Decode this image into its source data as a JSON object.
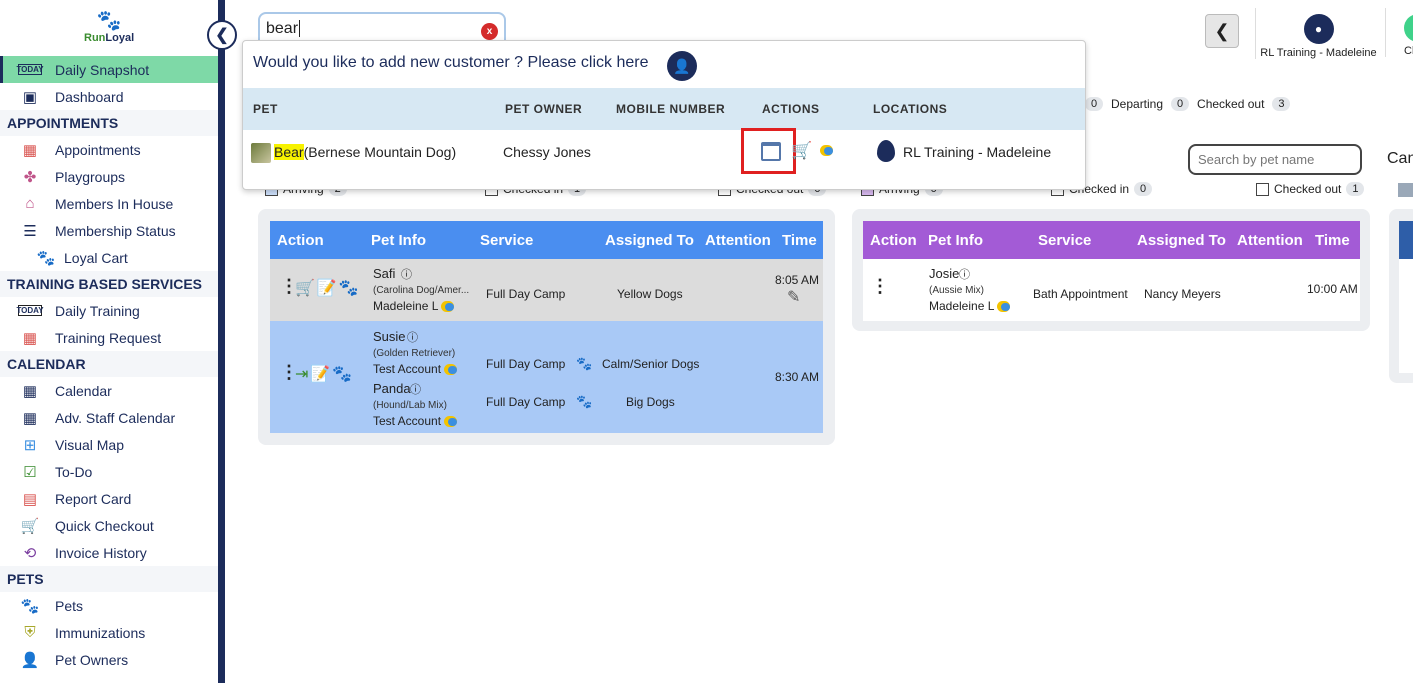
{
  "brand": {
    "logo_text_a": "Run",
    "logo_text_b": "Loyal"
  },
  "sidebar": {
    "items": [
      {
        "label": "Daily Snapshot",
        "icon": "today-icon",
        "active": true
      },
      {
        "label": "Dashboard",
        "icon": "dashboard-icon"
      }
    ],
    "sections": [
      {
        "title": "APPOINTMENTS",
        "items": [
          "Appointments",
          "Playgroups",
          "Members In House",
          "Membership Status",
          "Loyal Cart"
        ]
      },
      {
        "title": "TRAINING BASED SERVICES",
        "items": [
          "Daily Training",
          "Training Request"
        ]
      },
      {
        "title": "CALENDAR",
        "items": [
          "Calendar",
          "Adv. Staff Calendar",
          "Visual Map",
          "To-Do",
          "Report Card",
          "Quick Checkout",
          "Invoice History"
        ]
      },
      {
        "title": "PETS",
        "items": [
          "Pets",
          "Immunizations",
          "Pet Owners"
        ]
      }
    ]
  },
  "search": {
    "value": "bear",
    "clear_label": "x"
  },
  "header": {
    "location_label": "RL Training - Madeleine",
    "next_label": "Clo"
  },
  "status_bar": {
    "count_a": "0",
    "departing_label": "Departing",
    "departing_count": "0",
    "checked_out_label": "Checked out",
    "checked_out_count": "3"
  },
  "pet_search_placeholder": "Search by pet name",
  "cam_label": "Can",
  "filters": {
    "arriving": "Arriving",
    "arriving_count": "2",
    "checked_in": "Checked in",
    "checked_in_count": "1",
    "checked_out": "Checked out",
    "checked_out_count": "0",
    "arriving2": "Arriving",
    "arriving2_count": "0",
    "checked_in2": "Checked in",
    "checked_in2_count": "0",
    "checked_out2": "Checked out",
    "checked_out2_count": "1"
  },
  "table_headers": [
    "Action",
    "Pet Info",
    "Service",
    "Assigned To",
    "Attention",
    "Time"
  ],
  "blue_table": {
    "rows": [
      {
        "pet": "Safi",
        "breed": "(Carolina Dog/Amer...",
        "owner": "Madeleine L",
        "service": "Full Day Camp",
        "assigned": "Yellow Dogs",
        "time": "8:05 AM"
      },
      {
        "pet": "Susie",
        "breed": "(Golden Retriever)",
        "owner": "Test Account",
        "service": "Full Day Camp",
        "assigned": "Calm/Senior Dogs",
        "time": "8:30 AM",
        "pet2": "Panda",
        "breed2": "(Hound/Lab Mix)",
        "owner2": "Test Account",
        "service2": "Full Day Camp",
        "assigned2": "Big Dogs"
      }
    ]
  },
  "purple_table": {
    "rows": [
      {
        "pet": "Josie",
        "breed": "(Aussie Mix)",
        "owner": "Madeleine L",
        "service": "Bath Appointment",
        "assigned": "Nancy Meyers",
        "time": "10:00 AM"
      }
    ]
  },
  "dropdown": {
    "prompt": "Would you like to add new customer ? Please click here",
    "columns": [
      "PET",
      "PET OWNER",
      "MOBILE NUMBER",
      "ACTIONS",
      "LOCATIONS"
    ],
    "result": {
      "pet_highlight": "Bear",
      "pet_rest": "(Bernese Mountain Dog)",
      "owner": "Chessy Jones",
      "mobile": "",
      "location": "RL Training - Madeleine"
    }
  },
  "colors": {
    "navy": "#1c2c5b",
    "active_nav": "#7ed9a7",
    "blue_header": "#4a8ef0",
    "purple_header": "#a35bd6",
    "highlight_box": "#e02020"
  }
}
